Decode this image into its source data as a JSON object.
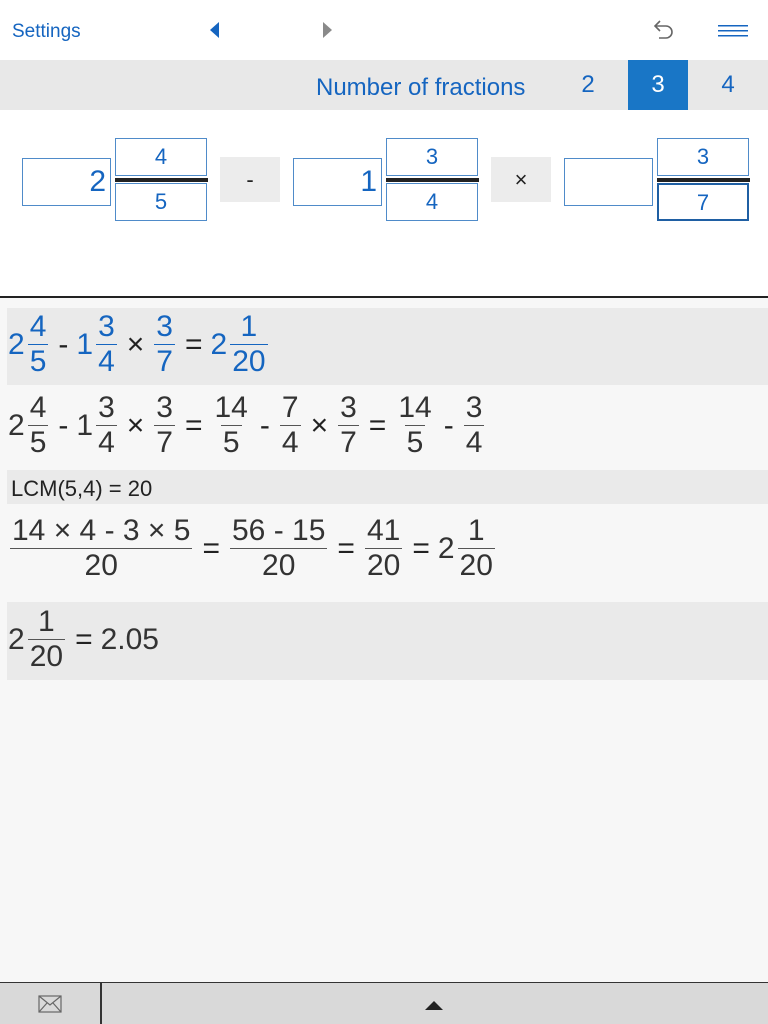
{
  "topbar": {
    "settings_label": "Settings",
    "icons": [
      "chevron-left-icon",
      "chevron-right-icon",
      "undo-icon",
      "menu-icon"
    ]
  },
  "count": {
    "label": "Number of fractions",
    "options": [
      "2",
      "3",
      "4"
    ],
    "selected": "3"
  },
  "inputs": {
    "f1": {
      "whole": "2",
      "num": "4",
      "den": "5"
    },
    "op1": "-",
    "f2": {
      "whole": "1",
      "num": "3",
      "den": "4"
    },
    "op2": "×",
    "f3": {
      "whole": "",
      "num": "3",
      "den": "7"
    }
  },
  "results": {
    "line1": {
      "f1w": "2",
      "f1n": "4",
      "f1d": "5",
      "op1": "-",
      "f2w": "1",
      "f2n": "3",
      "f2d": "4",
      "op2": "×",
      "f3n": "3",
      "f3d": "7",
      "eq": "=",
      "rw": "2",
      "rn": "1",
      "rd": "20"
    },
    "line2": {
      "f1w": "2",
      "f1n": "4",
      "f1d": "5",
      "op1": "-",
      "f2w": "1",
      "f2n": "3",
      "f2d": "4",
      "op2": "×",
      "f3n": "3",
      "f3d": "7",
      "eq1": "=",
      "a_n": "14",
      "a_d": "5",
      "op3": "-",
      "b_n": "7",
      "b_d": "4",
      "op4": "×",
      "c_n": "3",
      "c_d": "7",
      "eq2": "=",
      "d_n": "14",
      "d_d": "5",
      "op5": "-",
      "e_n": "3",
      "e_d": "4"
    },
    "lcm": "LCM(5,4) = 20",
    "line3": {
      "n1": "14 × 4 - 3 × 5",
      "d1": "20",
      "eq1": "=",
      "n2": "56 - 15",
      "d2": "20",
      "eq2": "=",
      "n3": "41",
      "d3": "20",
      "eq3": "=",
      "rw": "2",
      "rn": "1",
      "rd": "20"
    },
    "line4": {
      "w": "2",
      "n": "1",
      "d": "20",
      "eq": "=",
      "decimal": "2.05"
    }
  },
  "bottombar": {
    "icons": [
      "mail-icon",
      "chevron-up-icon"
    ]
  }
}
